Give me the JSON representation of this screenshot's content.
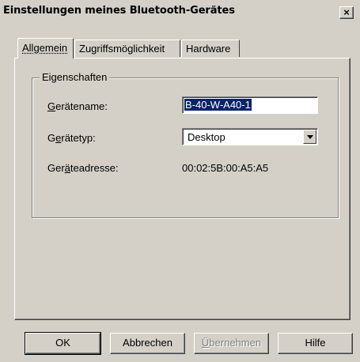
{
  "window": {
    "title": "Einstellungen meines Bluetooth-Gerätes",
    "close_label": "×"
  },
  "tabs": [
    {
      "label": "Allgemein",
      "active": true
    },
    {
      "label": "Zugriffsmöglichkeit",
      "active": false
    },
    {
      "label": "Hardware",
      "active": false
    }
  ],
  "group": {
    "legend": "Eigenschaften",
    "fields": {
      "name": {
        "label_mnemonic": "G",
        "label_rest": "erätename:",
        "value": "B-40-W-A40-1"
      },
      "type": {
        "label_pre": "G",
        "label_mnemonic": "e",
        "label_rest": "rätetyp:",
        "value": "Desktop"
      },
      "address": {
        "label_pre": "Ger",
        "label_mnemonic": "ä",
        "label_rest": "teadresse:",
        "value": "00:02:5B:00:A5:A5"
      }
    }
  },
  "buttons": {
    "ok": "OK",
    "cancel": "Abbrechen",
    "apply_mnemonic": "Ü",
    "apply_rest": "bernehmen",
    "help": "Hilfe"
  }
}
